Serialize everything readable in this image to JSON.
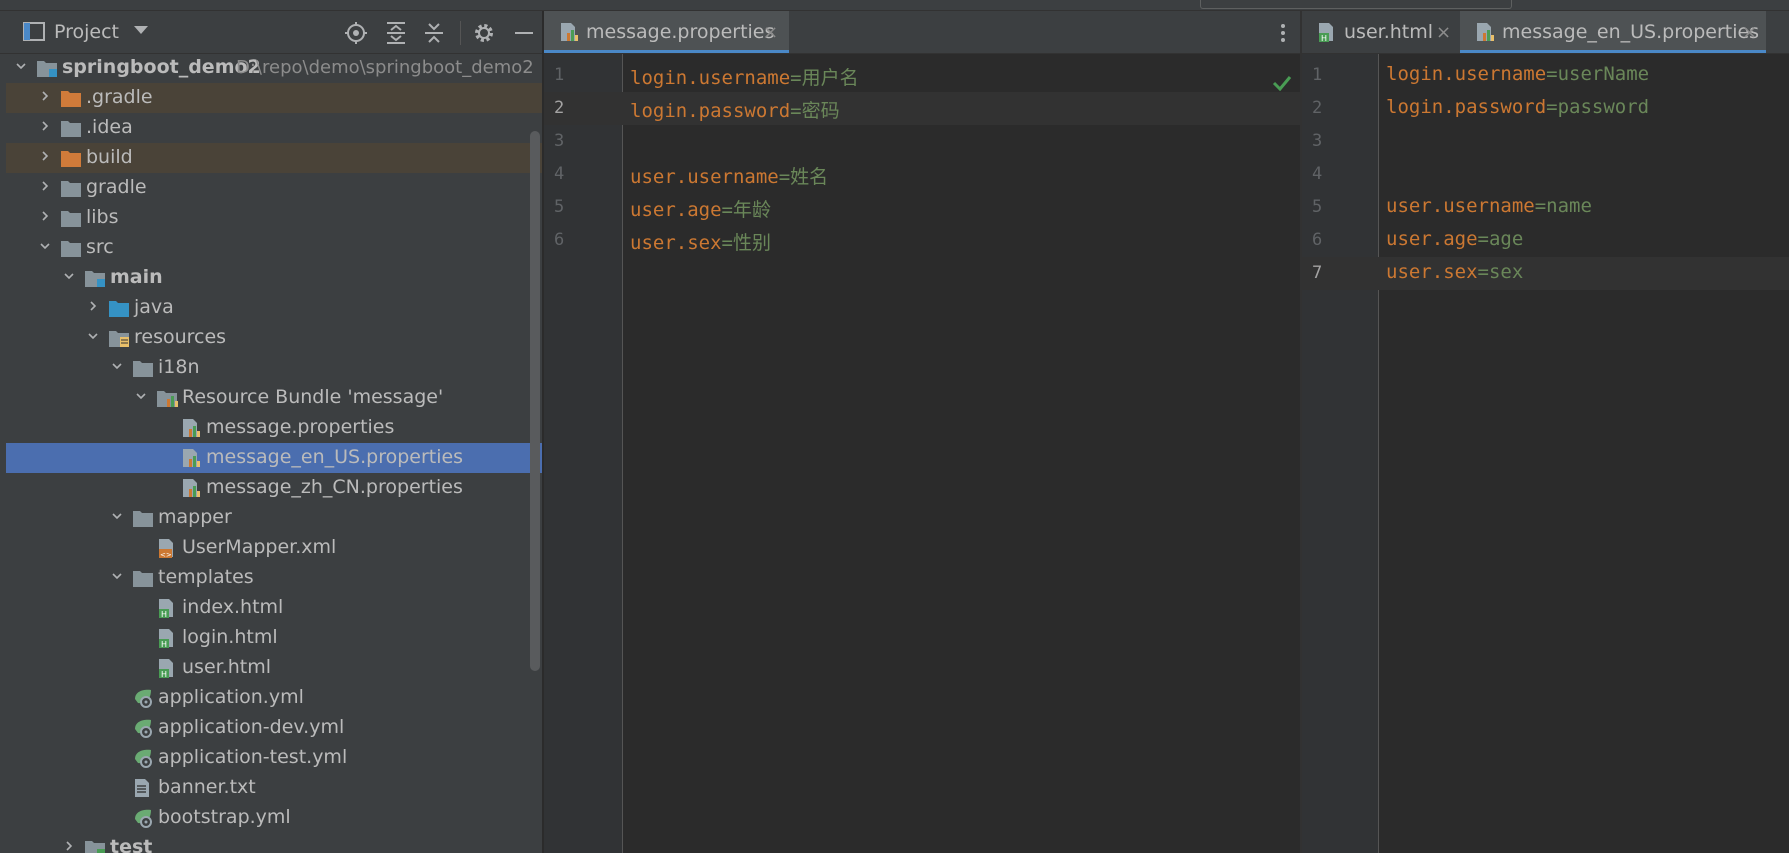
{
  "project_panel": {
    "title": "Project",
    "tree": [
      {
        "label": "springboot_demo2",
        "path": "D:\\repo\\demo\\springboot_demo2",
        "depth": 0,
        "expanded": true,
        "icon": "module-folder",
        "bold": true
      },
      {
        "label": ".gradle",
        "depth": 1,
        "expanded": false,
        "icon": "excluded-folder",
        "state": "ignored"
      },
      {
        "label": ".idea",
        "depth": 1,
        "expanded": false,
        "icon": "folder"
      },
      {
        "label": "build",
        "depth": 1,
        "expanded": false,
        "icon": "excluded-folder",
        "state": "ignored"
      },
      {
        "label": "gradle",
        "depth": 1,
        "expanded": false,
        "icon": "folder"
      },
      {
        "label": "libs",
        "depth": 1,
        "expanded": false,
        "icon": "folder"
      },
      {
        "label": "src",
        "depth": 1,
        "expanded": true,
        "icon": "folder"
      },
      {
        "label": "main",
        "depth": 2,
        "expanded": true,
        "icon": "source-root-folder",
        "bold": true
      },
      {
        "label": "java",
        "depth": 3,
        "expanded": false,
        "icon": "java-source-folder"
      },
      {
        "label": "resources",
        "depth": 3,
        "expanded": true,
        "icon": "resources-folder"
      },
      {
        "label": "i18n",
        "depth": 4,
        "expanded": true,
        "icon": "folder"
      },
      {
        "label": "Resource Bundle 'message'",
        "depth": 5,
        "expanded": true,
        "icon": "resource-bundle"
      },
      {
        "label": "message.properties",
        "depth": 6,
        "icon": "properties-file"
      },
      {
        "label": "message_en_US.properties",
        "depth": 6,
        "icon": "properties-file",
        "state": "selected"
      },
      {
        "label": "message_zh_CN.properties",
        "depth": 6,
        "icon": "properties-file"
      },
      {
        "label": "mapper",
        "depth": 4,
        "expanded": true,
        "icon": "folder"
      },
      {
        "label": "UserMapper.xml",
        "depth": 5,
        "icon": "xml-file"
      },
      {
        "label": "templates",
        "depth": 4,
        "expanded": true,
        "icon": "folder"
      },
      {
        "label": "index.html",
        "depth": 5,
        "icon": "html-file"
      },
      {
        "label": "login.html",
        "depth": 5,
        "icon": "html-file"
      },
      {
        "label": "user.html",
        "depth": 5,
        "icon": "html-file"
      },
      {
        "label": "application.yml",
        "depth": 4,
        "icon": "spring-yml-file"
      },
      {
        "label": "application-dev.yml",
        "depth": 4,
        "icon": "spring-yml-file"
      },
      {
        "label": "application-test.yml",
        "depth": 4,
        "icon": "spring-yml-file"
      },
      {
        "label": "banner.txt",
        "depth": 4,
        "icon": "text-file"
      },
      {
        "label": "bootstrap.yml",
        "depth": 4,
        "icon": "spring-yml-file"
      },
      {
        "label": "test",
        "depth": 2,
        "expanded": false,
        "icon": "test-folder",
        "bold": true
      }
    ],
    "toolbar_icons": [
      "locate-icon",
      "expand-all-icon",
      "collapse-all-icon",
      "gear-icon",
      "minimize-icon"
    ]
  },
  "left_editor": {
    "tabs": [
      {
        "label": "message.properties",
        "icon": "properties-file",
        "active": true,
        "close": "×"
      }
    ],
    "line_numbers": [
      "1",
      "2",
      "3",
      "4",
      "5",
      "6"
    ],
    "current_line": 2,
    "lines": [
      {
        "key": "login.username",
        "eq": "=",
        "value": "用户名"
      },
      {
        "key": "login.password",
        "eq": "=",
        "value": "密码"
      },
      {
        "key": "",
        "eq": "",
        "value": ""
      },
      {
        "key": "user.username",
        "eq": "=",
        "value": "姓名"
      },
      {
        "key": "user.age",
        "eq": "=",
        "value": "年龄"
      },
      {
        "key": "user.sex",
        "eq": "=",
        "value": "性别"
      }
    ]
  },
  "right_editor": {
    "tabs": [
      {
        "label": "user.html",
        "icon": "html-file",
        "active": false,
        "close": "×"
      },
      {
        "label": "message_en_US.properties",
        "icon": "properties-file",
        "active": true,
        "close": "×"
      }
    ],
    "line_numbers": [
      "1",
      "2",
      "3",
      "4",
      "5",
      "6",
      "7"
    ],
    "current_line": 7,
    "lines": [
      {
        "key": "login.username",
        "eq": "=",
        "value": "userName"
      },
      {
        "key": "login.password",
        "eq": "=",
        "value": "password"
      },
      {
        "key": "",
        "eq": "",
        "value": ""
      },
      {
        "key": "",
        "eq": "",
        "value": ""
      },
      {
        "key": "user.username",
        "eq": "=",
        "value": "name"
      },
      {
        "key": "user.age",
        "eq": "=",
        "value": "age"
      },
      {
        "key": "user.sex",
        "eq": "=",
        "value": "sex"
      }
    ]
  },
  "colors": {
    "key": "#cc7832",
    "value": "#6a8759",
    "selection": "#4b6eaf",
    "ignored": "#4a4338",
    "accent": "#4a88c7",
    "check": "#499c54"
  }
}
